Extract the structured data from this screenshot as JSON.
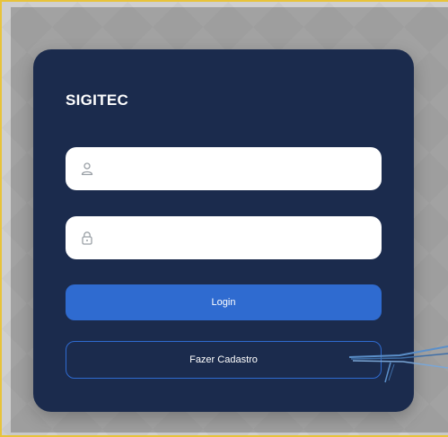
{
  "login_card": {
    "brand": "SIGITEC",
    "username_field": {
      "icon": "user-icon",
      "value": "",
      "placeholder": ""
    },
    "password_field": {
      "icon": "lock-icon",
      "value": "",
      "placeholder": ""
    },
    "login_button_label": "Login",
    "register_button_label": "Fazer Cadastro"
  },
  "colors": {
    "card_background": "#1b2b4d",
    "primary_button": "#2f6bd0",
    "input_background": "#ffffff",
    "frame_accent": "#e8c33a"
  }
}
